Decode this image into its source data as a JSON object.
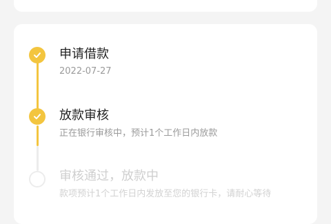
{
  "steps": [
    {
      "title": "申请借款",
      "subtitle": "2022-07-27",
      "status": "done",
      "icon": "check-icon"
    },
    {
      "title": "放款审核",
      "subtitle": "正在银行审核中，预计1个工作日内放款",
      "status": "done",
      "icon": "check-icon"
    },
    {
      "title": "审核通过，放款中",
      "subtitle": "款项预计1个工作日内发放至您的银行卡，请耐心等待",
      "status": "pending",
      "icon": "empty-circle-icon"
    }
  ],
  "colors": {
    "accent": "#f3c53f",
    "inactive": "#ececec"
  }
}
